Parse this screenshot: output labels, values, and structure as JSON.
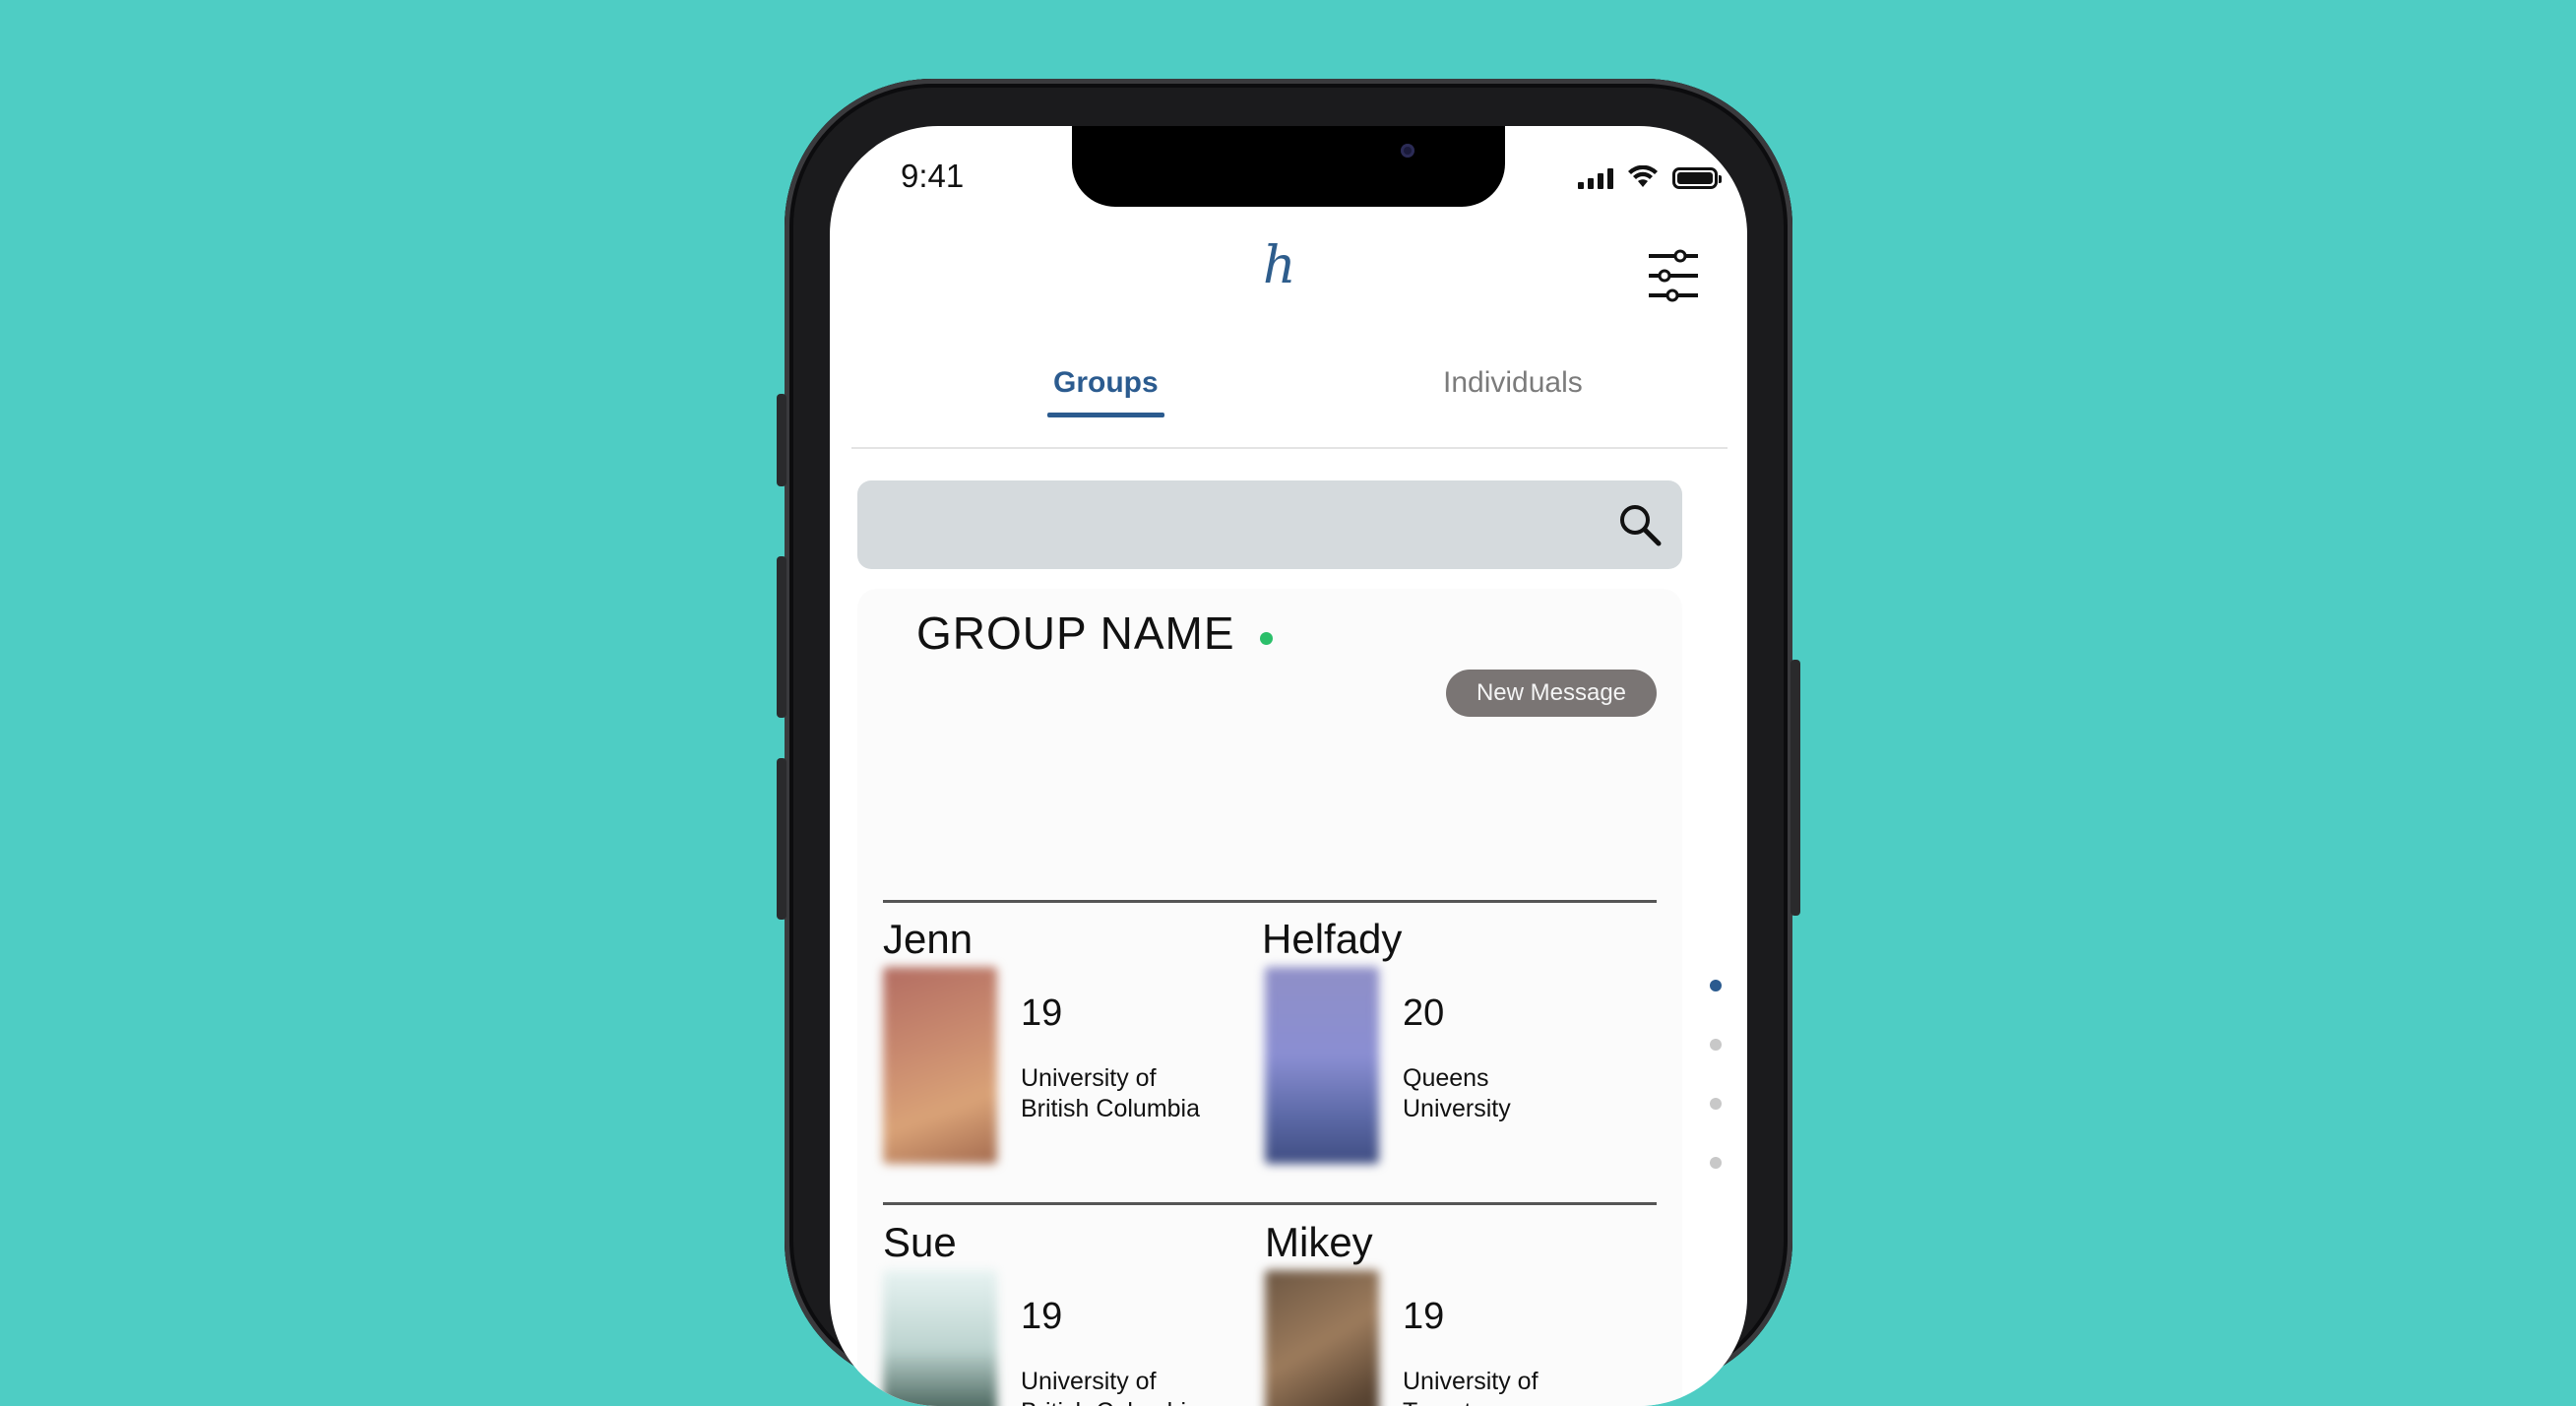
{
  "status_bar": {
    "time": "9:41"
  },
  "header": {
    "logo": "h"
  },
  "tabs": [
    {
      "label": "Groups",
      "active": true
    },
    {
      "label": "Individuals",
      "active": false
    }
  ],
  "search": {
    "placeholder": ""
  },
  "group": {
    "name": "GROUP NAME",
    "online": true,
    "new_message_label": "New Message"
  },
  "members": [
    {
      "name": "Jenn",
      "age": "19",
      "school": "University of British Columbia"
    },
    {
      "name": "Helfady",
      "age": "20",
      "school": "Queens University"
    },
    {
      "name": "Sue",
      "age": "19",
      "school": "University of British Columbia"
    },
    {
      "name": "Mikey",
      "age": "19",
      "school": "University of Toronto"
    }
  ],
  "pagination": {
    "total": 4,
    "active": 1
  },
  "colors": {
    "background": "#4ecdc4",
    "accent": "#2b5b8f",
    "online": "#2bbf6a",
    "button": "#7a7574"
  }
}
